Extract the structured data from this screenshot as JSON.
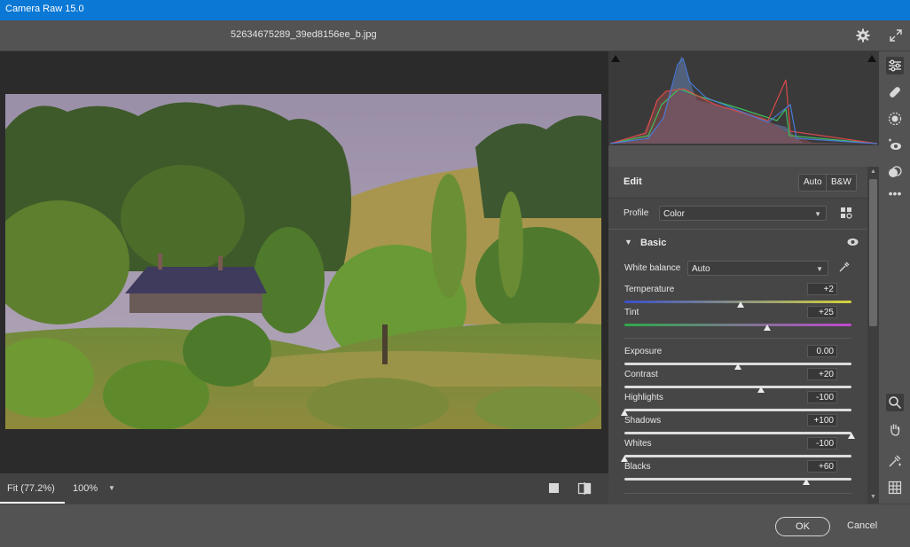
{
  "window": {
    "title": "Camera Raw 15.0"
  },
  "header": {
    "filename": "52634675289_39ed8156ee_b.jpg"
  },
  "view": {
    "fit_label": "Fit (77.2%)",
    "zoom_label": "100%"
  },
  "edit": {
    "title": "Edit",
    "auto_label": "Auto",
    "bw_label": "B&W",
    "profile_label": "Profile",
    "profile_value": "Color",
    "basic_label": "Basic",
    "white_balance_label": "White balance",
    "white_balance_value": "Auto",
    "sliders": [
      {
        "label": "Temperature",
        "value": "+2",
        "position": 0.51
      },
      {
        "label": "Tint",
        "value": "+25",
        "position": 0.63
      },
      {
        "label": "Exposure",
        "value": "0.00",
        "position": 0.5
      },
      {
        "label": "Contrast",
        "value": "+20",
        "position": 0.6
      },
      {
        "label": "Highlights",
        "value": "-100",
        "position": 0.0
      },
      {
        "label": "Shadows",
        "value": "+100",
        "position": 1.0
      },
      {
        "label": "Whites",
        "value": "-100",
        "position": 0.0
      },
      {
        "label": "Blacks",
        "value": "+60",
        "position": 0.8
      }
    ]
  },
  "footer": {
    "ok_label": "OK",
    "cancel_label": "Cancel"
  },
  "colors": {
    "accent_titlebar": "#0a78d4",
    "panel_bg": "#464646",
    "preview_bg": "#2b2b2b"
  },
  "icons": [
    "gear-icon",
    "fullscreen-icon",
    "edit-sliders-icon",
    "healing-icon",
    "masking-icon",
    "red-eye-icon",
    "presets-icon",
    "more-icon",
    "zoom-icon",
    "hand-icon",
    "color-sampler-icon",
    "grid-icon",
    "eye-icon",
    "eyedropper-icon",
    "profile-browser-icon"
  ]
}
